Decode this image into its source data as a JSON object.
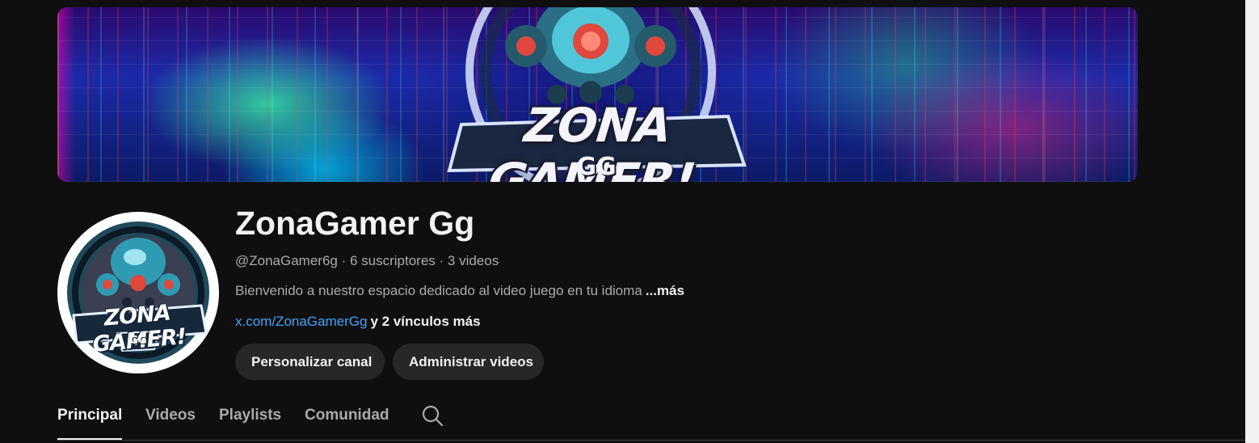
{
  "banner": {
    "logo_text": "ZONA GAMER!",
    "logo_sub": "GG"
  },
  "avatar": {
    "logo_text": "ZONA GAMER!",
    "logo_sub": "GG"
  },
  "channel": {
    "name": "ZonaGamer Gg",
    "meta": "@ZonaGamer6g · 6 suscriptores · 3 videos",
    "description": "Bienvenido a nuestro espacio dedicado al video juego en tu idioma",
    "description_more": "...más",
    "link_main": "x.com/ZonaGamerGg",
    "link_more": "y 2 vínculos más"
  },
  "buttons": {
    "customize": "Personalizar canal",
    "manage": "Administrar videos"
  },
  "tabs": [
    {
      "label": "Principal",
      "active": true
    },
    {
      "label": "Videos",
      "active": false
    },
    {
      "label": "Playlists",
      "active": false
    },
    {
      "label": "Comunidad",
      "active": false
    }
  ],
  "icons": {
    "search": "search-icon"
  },
  "colors": {
    "background": "#0f0f0f",
    "text_primary": "#f1f1f1",
    "text_secondary": "#aaaaaa",
    "link": "#3ea6ff",
    "button_bg": "#272727"
  }
}
